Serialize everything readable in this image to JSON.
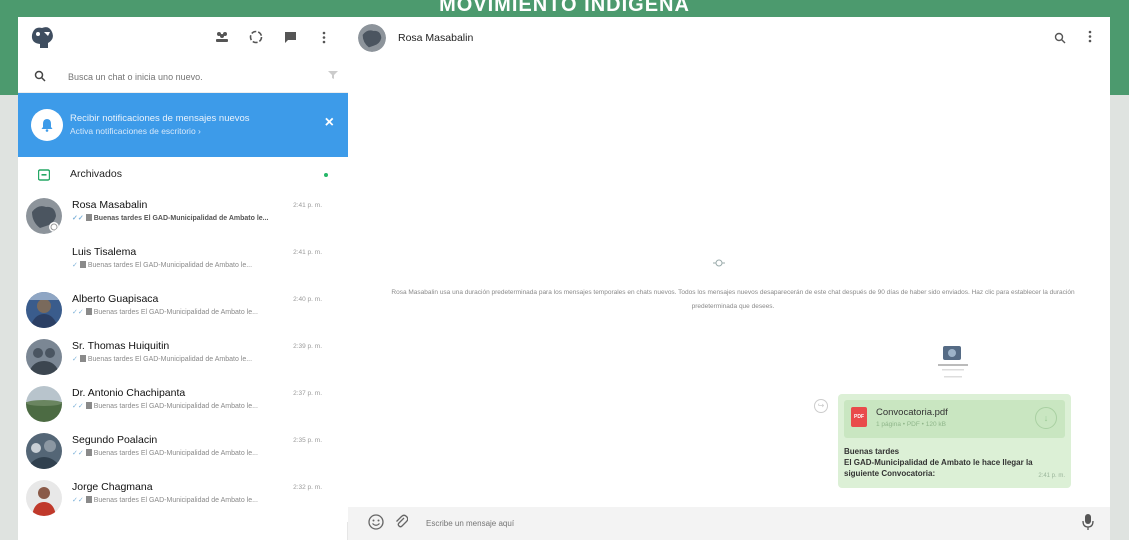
{
  "document": {
    "title": "MOVIMIENTO INDÍGENA"
  },
  "sidebar": {
    "search": {
      "placeholder": "Busca un chat o inicia uno nuevo."
    },
    "notification": {
      "title": "Recibir notificaciones de mensajes nuevos",
      "subtitle": "Activa notificaciones de escritorio ›"
    },
    "archived": {
      "label": "Archivados"
    },
    "chats": [
      {
        "name": "Rosa Masabalin",
        "time": "2:41 p. m.",
        "preview": "Buenas tardes El GAD-Municipalidad de Ambato le...",
        "active": true,
        "avatar": "rosa"
      },
      {
        "name": "Luis Tisalema",
        "time": "2:41 p. m.",
        "preview": "Buenas tardes El GAD-Municipalidad de Ambato le...",
        "active": false,
        "avatar": "none"
      },
      {
        "name": "Alberto Guapisaca",
        "time": "2:40 p. m.",
        "preview": "Buenas tardes El GAD-Municipalidad de Ambato le...",
        "active": false,
        "avatar": "alberto"
      },
      {
        "name": "Sr. Thomas Huiquitin",
        "time": "2:39 p. m.",
        "preview": "Buenas tardes El GAD-Municipalidad de Ambato le...",
        "active": false,
        "avatar": "thomas"
      },
      {
        "name": "Dr. Antonio Chachipanta",
        "time": "2:37 p. m.",
        "preview": "Buenas tardes El GAD-Municipalidad de Ambato le...",
        "active": false,
        "avatar": "antonio"
      },
      {
        "name": "Segundo Poalacin",
        "time": "2:35 p. m.",
        "preview": "Buenas tardes El GAD-Municipalidad de Ambato le...",
        "active": false,
        "avatar": "segundo"
      },
      {
        "name": "Jorge Chagmana",
        "time": "2:32 p. m.",
        "preview": "Buenas tardes El GAD-Municipalidad de Ambato le...",
        "active": false,
        "avatar": "jorge"
      }
    ]
  },
  "conversation": {
    "contact_name": "Rosa Masabalin",
    "system_message": "Rosa Masabalin usa una duración predeterminada para los mensajes temporales en chats nuevos. Todos los mensajes nuevos desaparecerán de este chat después de 90 días de haber sido enviados. Haz clic para establecer la duración predeterminada que desees.",
    "message": {
      "file_name": "Convocatoria.pdf",
      "file_meta": "1 página • PDF • 120 kB",
      "text_line1": "Buenas tardes",
      "text_line2": "El GAD-Municipalidad de Ambato le hace llegar la siguiente Convocatoria:",
      "time": "2:41 p. m."
    },
    "composer": {
      "placeholder": "Escribe un mensaje aquí"
    }
  },
  "colors": {
    "header_band": "#4c9a6e",
    "notification": "#3d9be9",
    "bubble": "#dcf0d6"
  }
}
